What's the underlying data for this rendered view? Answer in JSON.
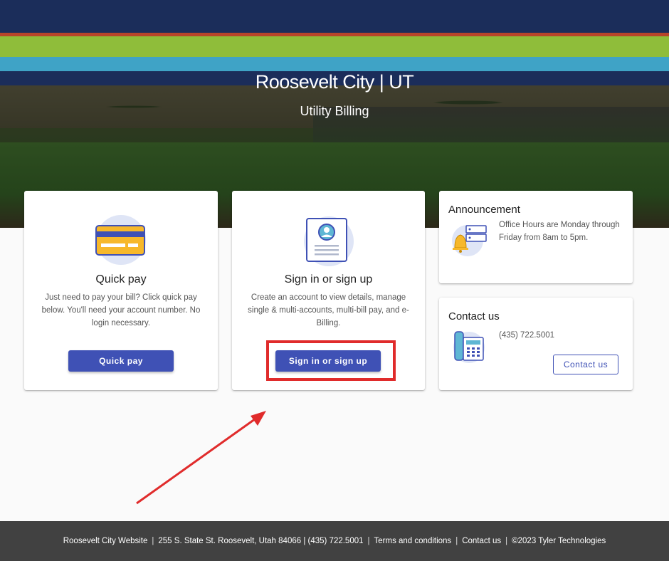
{
  "header": {
    "title": "Roosevelt City | UT",
    "subtitle": "Utility Billing"
  },
  "colors": {
    "navy": "#1b2d5a",
    "green": "#8fbd3a",
    "light_blue": "#3fa3c6",
    "primary": "#3f51b5",
    "highlight": "#e02b2b"
  },
  "quick_pay": {
    "icon": "credit-card-icon",
    "title": "Quick pay",
    "description": "Just need to pay your bill? Click quick pay below. You'll need your account number. No login necessary.",
    "button_label": "Quick pay"
  },
  "sign_in": {
    "icon": "user-profile-document-icon",
    "title": "Sign in or sign up",
    "description": "Create an account to view details, manage single & multi-accounts, multi-bill pay, and e-Billing.",
    "button_label": "Sign in or sign up"
  },
  "announcement": {
    "icon": "bell-announcement-icon",
    "title": "Announcement",
    "text": "Office Hours are Monday through Friday from 8am to 5pm."
  },
  "contact": {
    "icon": "desk-phone-icon",
    "title": "Contact us",
    "phone": "(435) 722.5001",
    "button_label": "Contact us"
  },
  "footer": {
    "website": "Roosevelt City Website",
    "address": "255 S. State St. Roosevelt, Utah 84066 | (435) 722.5001",
    "terms": "Terms and conditions",
    "contact": "Contact us",
    "copyright": "©2023 Tyler Technologies",
    "separator": "|"
  }
}
